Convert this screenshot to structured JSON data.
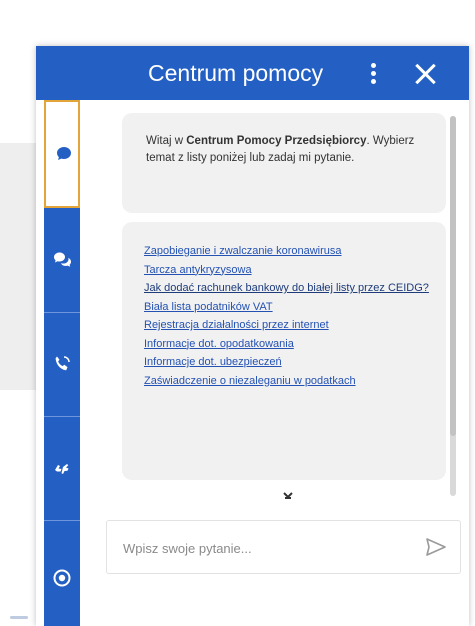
{
  "header": {
    "title": "Centrum pomocy"
  },
  "welcome": {
    "prefix": "Witaj w ",
    "brand": "Centrum Pomocy Przedsiębiorcy",
    "suffix": ". Wybierz temat z listy poniżej lub zadaj mi pytanie."
  },
  "links": [
    "Zapobieganie i zwalczanie koronawirusa",
    "Tarcza antykryzysowa",
    "Jak dodać rachunek bankowy do białej listy przez CEIDG?",
    "Biała lista podatników VAT",
    "Rejestracja działalności przez internet",
    "Informacje dot. opodatkowania",
    "Informacje dot. ubezpieczeń",
    "Zaświadczenie o niezaleganiu w podatkach"
  ],
  "input": {
    "placeholder": "Wpisz swoje pytanie..."
  },
  "sidebar": {
    "items": [
      {
        "icon": "chat-bubble-icon",
        "active": true
      },
      {
        "icon": "conversation-icon",
        "active": false
      },
      {
        "icon": "phone-icon",
        "active": false
      },
      {
        "icon": "sign-language-icon",
        "active": false
      },
      {
        "icon": "accessibility-icon",
        "active": false
      }
    ]
  },
  "colors": {
    "brand": "#2460c3",
    "active_border": "#e3a43a",
    "link": "#2452b3"
  }
}
